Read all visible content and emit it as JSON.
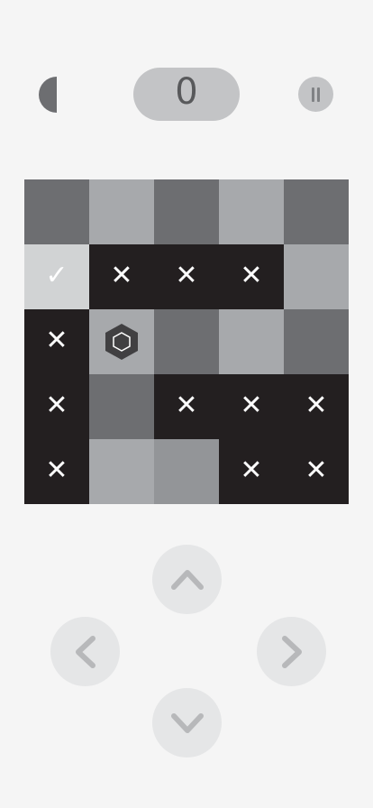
{
  "header": {
    "timer_icon": "half-circle-timer-icon",
    "score": "0",
    "pause_icon": "pause-icon"
  },
  "board": {
    "rows": 5,
    "cols": 5,
    "colors": {
      "dark": "#6d6e71",
      "light": "#a7a9ac",
      "mid": "#939598",
      "pale": "#d1d3d4",
      "filled": "#231f20",
      "player": "#414042"
    },
    "cells": [
      {
        "fill": "dark",
        "mark": ""
      },
      {
        "fill": "light",
        "mark": ""
      },
      {
        "fill": "dark",
        "mark": ""
      },
      {
        "fill": "light",
        "mark": ""
      },
      {
        "fill": "dark",
        "mark": ""
      },
      {
        "fill": "pale",
        "mark": "✓"
      },
      {
        "fill": "filled",
        "mark": "✕"
      },
      {
        "fill": "filled",
        "mark": "✕"
      },
      {
        "fill": "filled",
        "mark": "✕"
      },
      {
        "fill": "light",
        "mark": ""
      },
      {
        "fill": "filled",
        "mark": "✕"
      },
      {
        "fill": "light",
        "mark": "",
        "player": true
      },
      {
        "fill": "dark",
        "mark": ""
      },
      {
        "fill": "light",
        "mark": ""
      },
      {
        "fill": "dark",
        "mark": ""
      },
      {
        "fill": "filled",
        "mark": "✕"
      },
      {
        "fill": "dark",
        "mark": ""
      },
      {
        "fill": "filled",
        "mark": "✕"
      },
      {
        "fill": "filled",
        "mark": "✕"
      },
      {
        "fill": "filled",
        "mark": "✕"
      },
      {
        "fill": "filled",
        "mark": "✕"
      },
      {
        "fill": "light",
        "mark": ""
      },
      {
        "fill": "mid",
        "mark": ""
      },
      {
        "fill": "filled",
        "mark": "✕"
      },
      {
        "fill": "filled",
        "mark": "✕"
      }
    ]
  },
  "controls": {
    "up": "chevron-up-icon",
    "left": "chevron-left-icon",
    "right": "chevron-right-icon",
    "down": "chevron-down-icon"
  }
}
